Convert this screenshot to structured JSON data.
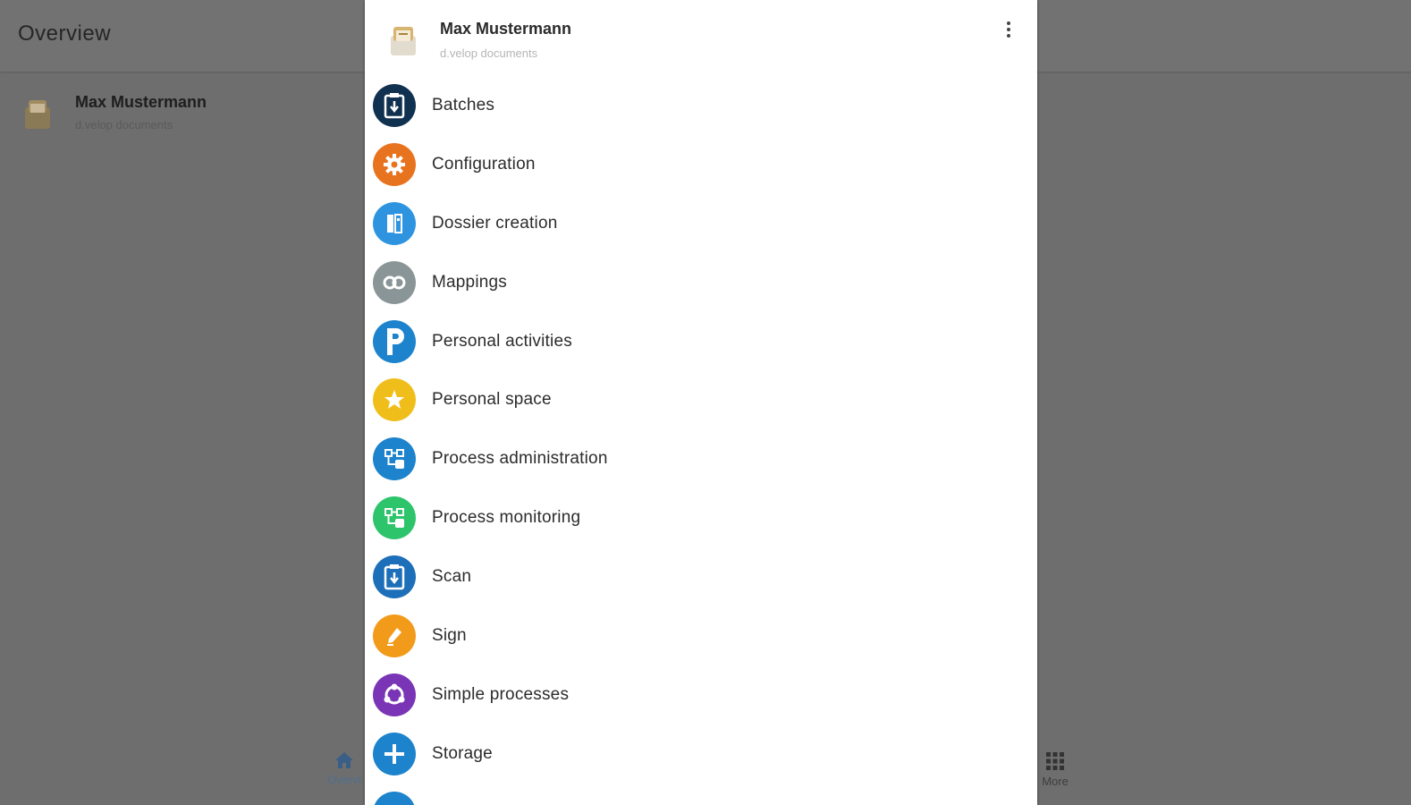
{
  "background": {
    "title": "Overview",
    "account": {
      "name": "Max Mustermann",
      "subtitle": "d.velop documents"
    },
    "nav": {
      "left_label": "Overvi",
      "right_label": "More"
    }
  },
  "drawer": {
    "user": {
      "name": "Max Mustermann",
      "subtitle": "d.velop documents"
    },
    "menu_icon": "more-vert-icon",
    "items": [
      {
        "label": "Batches",
        "icon": "batch-download-icon",
        "color": "#10314f"
      },
      {
        "label": "Configuration",
        "icon": "gear-icon",
        "color": "#e8731f"
      },
      {
        "label": "Dossier creation",
        "icon": "dossier-icon",
        "color": "#2f94e0"
      },
      {
        "label": "Mappings",
        "icon": "link-icon",
        "color": "#8a9597"
      },
      {
        "label": "Personal activities",
        "icon": "p-letter-icon",
        "color": "#1c83cc"
      },
      {
        "label": "Personal space",
        "icon": "star-icon",
        "color": "#f0be1a"
      },
      {
        "label": "Process administration",
        "icon": "process-admin-icon",
        "color": "#1c83cc"
      },
      {
        "label": "Process monitoring",
        "icon": "process-monitor-icon",
        "color": "#2ec46c"
      },
      {
        "label": "Scan",
        "icon": "scan-icon",
        "color": "#1c6fb8"
      },
      {
        "label": "Sign",
        "icon": "pen-icon",
        "color": "#f29a19"
      },
      {
        "label": "Simple processes",
        "icon": "cycle-icon",
        "color": "#7a34b6"
      },
      {
        "label": "Storage",
        "icon": "plus-icon",
        "color": "#1c83cc"
      }
    ]
  }
}
